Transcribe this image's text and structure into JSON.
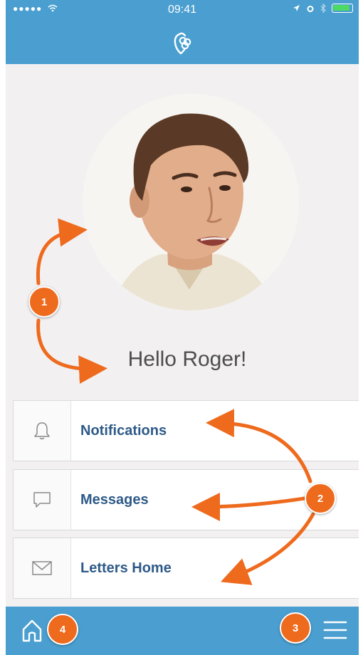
{
  "status_bar": {
    "signal": "●●●●●",
    "time": "09:41",
    "battery_level": 0.9
  },
  "header": {
    "logo_icon": "app-logo-icon"
  },
  "profile": {
    "avatar_icon": "user-avatar",
    "greeting": "Hello Roger!"
  },
  "menu": {
    "items": [
      {
        "label": "Notifications",
        "icon": "bell-icon"
      },
      {
        "label": "Messages",
        "icon": "chat-bubble-icon"
      },
      {
        "label": "Letters Home",
        "icon": "envelope-icon"
      }
    ]
  },
  "tabbar": {
    "home_icon": "home-icon",
    "menu_icon": "hamburger-menu-icon"
  },
  "annotations": {
    "badges": [
      "1",
      "2",
      "3",
      "4"
    ],
    "color": "#ee6a1d"
  },
  "colors": {
    "header_bg": "#4a9fd0",
    "page_bg": "#f2f0f1",
    "menu_text": "#2e5a88",
    "annotation": "#ee6a1d"
  }
}
